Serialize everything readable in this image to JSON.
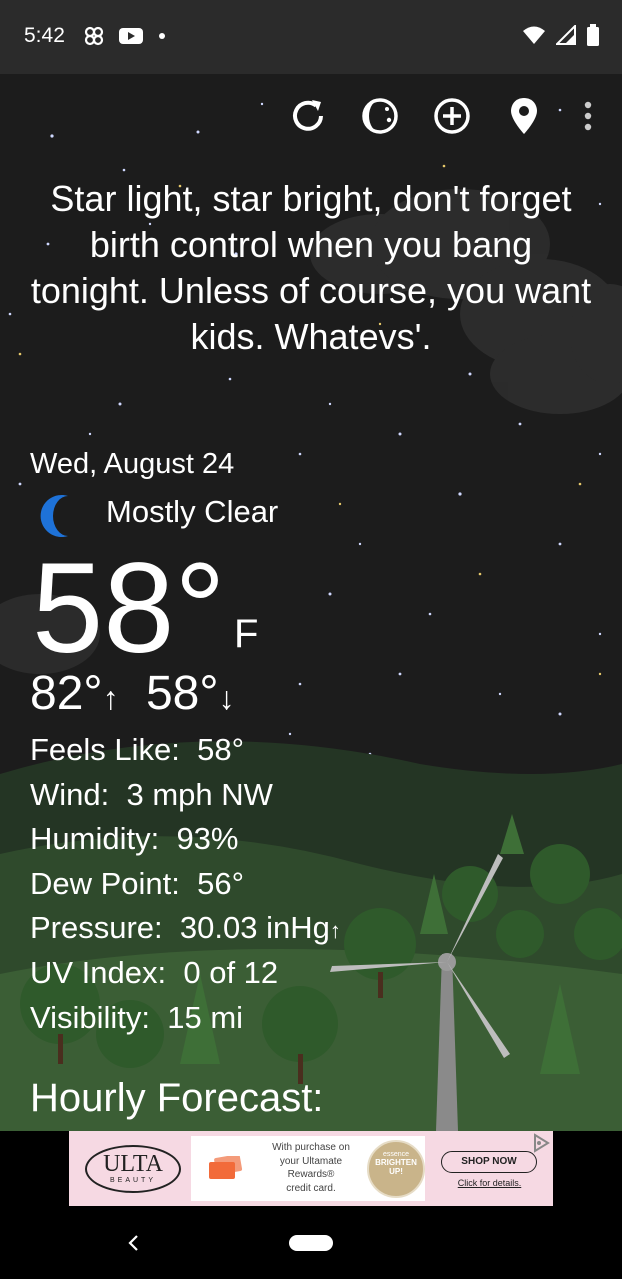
{
  "status": {
    "time": "5:42",
    "left_icons": [
      "pinwheel-icon",
      "youtube-icon",
      "dot-icon"
    ],
    "right_icons": [
      "wifi-icon",
      "signal-icon",
      "battery-icon"
    ]
  },
  "toolbar": {
    "icons": [
      "refresh-icon",
      "moon-phase-icon",
      "add-circle-icon",
      "location-pin-icon",
      "more-vert-icon"
    ]
  },
  "quote": "Star light, star bright, don't forget birth control when you bang tonight. Unless of course, you want kids. Whatevs'.",
  "weather": {
    "date": "Wed, August 24",
    "condition": "Mostly Clear",
    "condition_icon": "crescent-moon-icon",
    "temperature": "58°",
    "unit": "F",
    "high": "82°",
    "low": "58°",
    "details": [
      {
        "label": "Feels Like:",
        "value": "58°"
      },
      {
        "label": "Wind:",
        "value": "3 mph NW"
      },
      {
        "label": "Humidity:",
        "value": "93%"
      },
      {
        "label": "Dew Point:",
        "value": "56°"
      },
      {
        "label": "Pressure:",
        "value": "30.03 inHg"
      },
      {
        "label": "UV Index:",
        "value": "0 of 12"
      },
      {
        "label": "Visibility:",
        "value": "15 mi"
      }
    ],
    "hourly_title": "Hourly Forecast:"
  },
  "ad": {
    "brand": "ULTA",
    "brand_sub": "BEAUTY",
    "text": [
      "With purchase on",
      "your Ultamate",
      "Rewards®",
      "credit card."
    ],
    "product_brand": "essence",
    "product_name": [
      "BRIGHTEN",
      "UP!"
    ],
    "cta": "SHOP NOW",
    "cta_sub": "Click for details."
  },
  "colors": {
    "sky": "#1c1c1c",
    "status_bar": "#2b2b2b",
    "moon_blue": "#1e72d8",
    "ad_background": "#f6d9e3"
  }
}
